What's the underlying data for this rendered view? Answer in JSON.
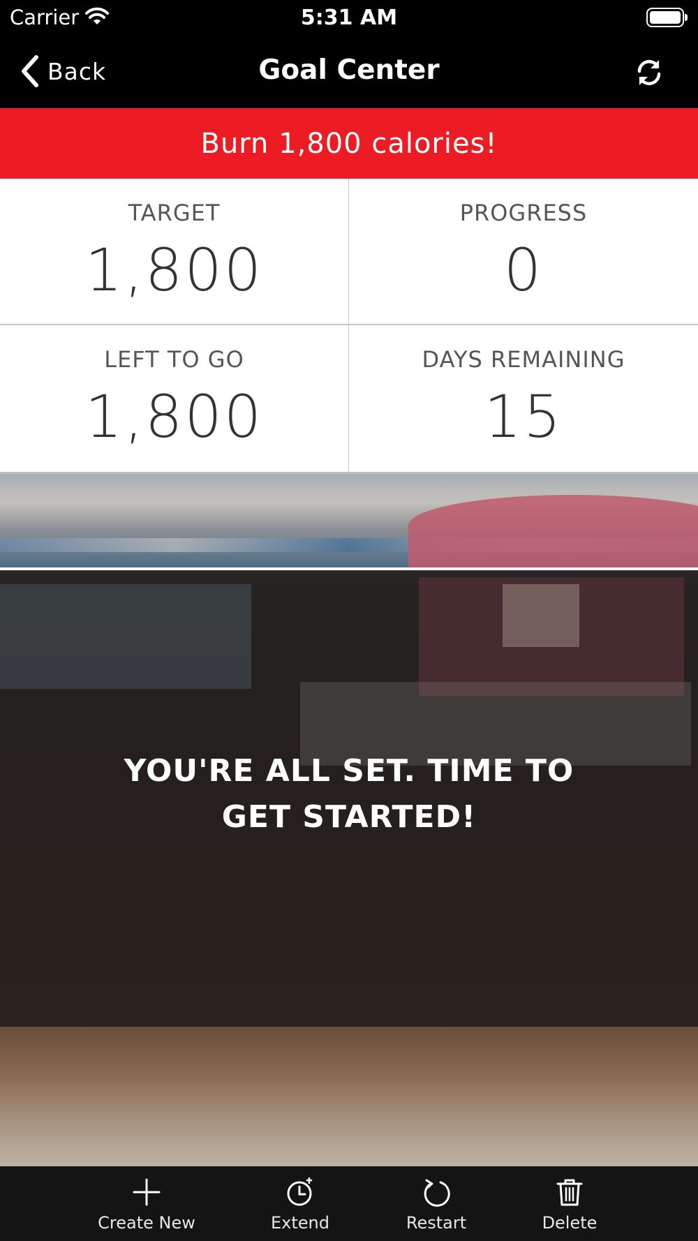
{
  "status_bar": {
    "carrier": "Carrier",
    "time": "5:31 AM",
    "wifi_icon": "wifi-icon",
    "battery_icon": "battery-icon"
  },
  "nav": {
    "back_label": "Back",
    "title": "Goal Center",
    "back_icon": "chevron-left-icon",
    "refresh_icon": "refresh-icon"
  },
  "goal": {
    "banner_text": "Burn 1,800 calories!",
    "banner_color": "#ed1c24"
  },
  "stats": {
    "target": {
      "label": "TARGET",
      "value": "1,800"
    },
    "progress": {
      "label": "PROGRESS",
      "value": "0"
    },
    "left_to_go": {
      "label": "LEFT TO GO",
      "value": "1,800"
    },
    "days_remaining": {
      "label": "DAYS REMAINING",
      "value": "15"
    }
  },
  "message": {
    "line1": "YOU'RE ALL SET. TIME TO",
    "line2": "GET STARTED!"
  },
  "tab_bar": {
    "create_new": {
      "label": "Create New",
      "icon": "plus-icon"
    },
    "extend": {
      "label": "Extend",
      "icon": "alarm-clock-icon"
    },
    "restart": {
      "label": "Restart",
      "icon": "restart-icon"
    },
    "delete": {
      "label": "Delete",
      "icon": "trash-icon"
    }
  }
}
